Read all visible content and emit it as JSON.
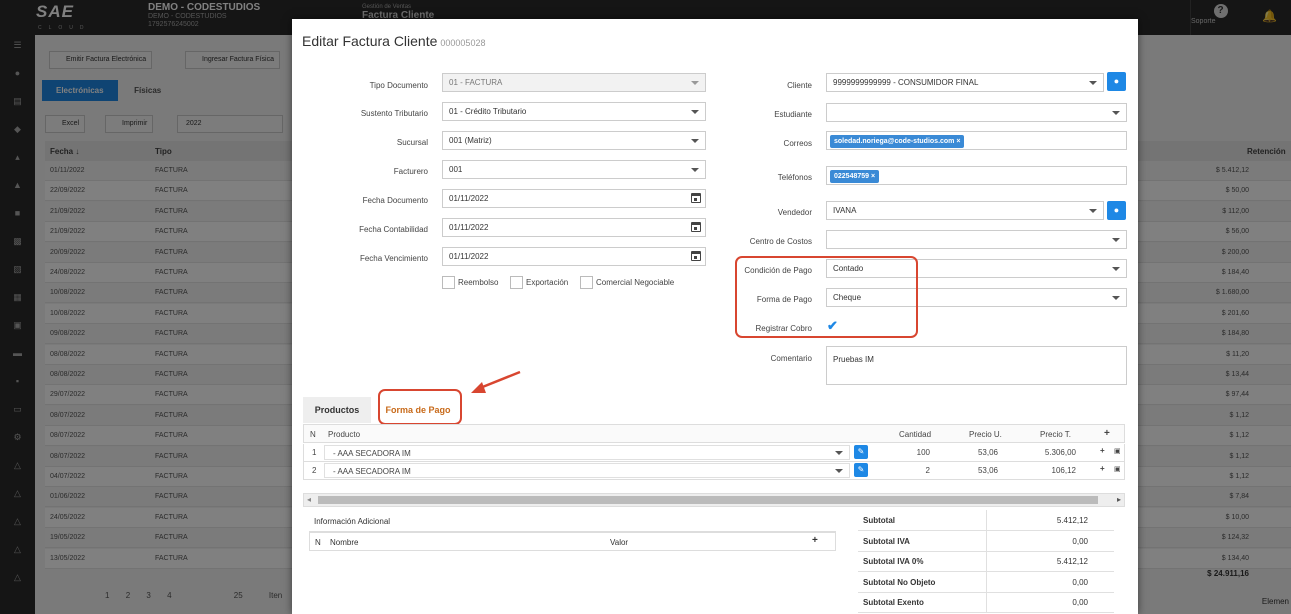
{
  "topbar": {
    "logo_text": "SAE",
    "logo_sub": "CLOUD",
    "company_name": "DEMO - CODESTUDIOS",
    "company_sub": "DEMO - CODESTUDIOS",
    "company_ruc": "1792576245002",
    "module_label": "Gestión de Ventas",
    "module_title": "Factura Cliente",
    "support_label": "Soporte"
  },
  "toolbar": {
    "emit_label": "Emitir Factura Electrónica",
    "ingresar_label": "Ingresar Factura Física",
    "excel_label": "Excel",
    "print_label": "Imprimir",
    "year_value": "2022"
  },
  "list_tabs": [
    "Electrónicas",
    "Físicas"
  ],
  "grid": {
    "col_fecha": "Fecha ↓",
    "col_tipo": "Tipo",
    "col_retencion": "Retención",
    "rows": [
      {
        "fecha": "01/11/2022",
        "tipo": "FACTURA",
        "total": "$ 5.412,12"
      },
      {
        "fecha": "22/09/2022",
        "tipo": "FACTURA",
        "total": "$ 50,00"
      },
      {
        "fecha": "21/09/2022",
        "tipo": "FACTURA",
        "total": "$ 112,00"
      },
      {
        "fecha": "21/09/2022",
        "tipo": "FACTURA",
        "total": "$ 56,00"
      },
      {
        "fecha": "20/09/2022",
        "tipo": "FACTURA",
        "total": "$ 200,00"
      },
      {
        "fecha": "24/08/2022",
        "tipo": "FACTURA",
        "total": "$ 184,40"
      },
      {
        "fecha": "10/08/2022",
        "tipo": "FACTURA",
        "total": "$ 1.680,00"
      },
      {
        "fecha": "10/08/2022",
        "tipo": "FACTURA",
        "total": "$ 201,60"
      },
      {
        "fecha": "09/08/2022",
        "tipo": "FACTURA",
        "total": "$ 184,80"
      },
      {
        "fecha": "08/08/2022",
        "tipo": "FACTURA",
        "total": "$ 11,20"
      },
      {
        "fecha": "08/08/2022",
        "tipo": "FACTURA",
        "total": "$ 13,44"
      },
      {
        "fecha": "29/07/2022",
        "tipo": "FACTURA",
        "total": "$ 97,44"
      },
      {
        "fecha": "08/07/2022",
        "tipo": "FACTURA",
        "total": "$ 1,12"
      },
      {
        "fecha": "08/07/2022",
        "tipo": "FACTURA",
        "total": "$ 1,12"
      },
      {
        "fecha": "08/07/2022",
        "tipo": "FACTURA",
        "total": "$ 1,12"
      },
      {
        "fecha": "04/07/2022",
        "tipo": "FACTURA",
        "total": "$ 1,12"
      },
      {
        "fecha": "01/06/2022",
        "tipo": "FACTURA",
        "total": "$ 7,84"
      },
      {
        "fecha": "24/05/2022",
        "tipo": "FACTURA",
        "total": "$ 10,00"
      },
      {
        "fecha": "19/05/2022",
        "tipo": "FACTURA",
        "total": "$ 124,32"
      },
      {
        "fecha": "13/05/2022",
        "tipo": "FACTURA",
        "total": "$ 134,40"
      }
    ],
    "grand_total": "$ 24.911,16",
    "pager_pages": [
      "1",
      "2",
      "3",
      "4"
    ],
    "page_size": "25",
    "pager_items_label": "Iten",
    "footer_right": "Elemen"
  },
  "modal": {
    "title": "Editar Factura Cliente",
    "number": "000005028",
    "left": {
      "tipo_doc_label": "Tipo Documento",
      "tipo_doc_value": "01 - FACTURA",
      "sustento_label": "Sustento Tributario",
      "sustento_value": "01 - Crédito Tributario",
      "sucursal_label": "Sucursal",
      "sucursal_value": "001 (Matriz)",
      "facturero_label": "Facturero",
      "facturero_value": "001",
      "fecha_doc_label": "Fecha Documento",
      "fecha_doc_value": "01/11/2022",
      "fecha_cont_label": "Fecha Contabilidad",
      "fecha_cont_value": "01/11/2022",
      "fecha_venc_label": "Fecha Vencimiento",
      "fecha_venc_value": "01/11/2022",
      "reembolso_label": "Reembolso",
      "exportacion_label": "Exportación",
      "comercial_label": "Comercial Negociable"
    },
    "right": {
      "cliente_label": "Cliente",
      "cliente_value": "9999999999999 - CONSUMIDOR FINAL",
      "estudiante_label": "Estudiante",
      "estudiante_value": "",
      "correos_label": "Correos",
      "correo_tag": "soledad.noriega@code-studios.com",
      "telefonos_label": "Teléfonos",
      "telefono_tag": "022548759",
      "vendedor_label": "Vendedor",
      "vendedor_value": "IVANA",
      "centro_label": "Centro de Costos",
      "centro_value": "",
      "condicion_label": "Condición de Pago",
      "condicion_value": "Contado",
      "forma_label": "Forma de Pago",
      "forma_value": "Cheque",
      "registrar_label": "Registrar Cobro",
      "registrar_checked": true,
      "comentario_label": "Comentario",
      "comentario_value": "Pruebas IM"
    },
    "tabs": [
      "Productos",
      "Forma de Pago"
    ],
    "products": {
      "headers": {
        "n": "N",
        "producto": "Producto",
        "cantidad": "Cantidad",
        "precio_u": "Precio U.",
        "precio_t": "Precio T."
      },
      "rows": [
        {
          "n": "1",
          "producto": "- AAA SECADORA IM",
          "cantidad": "100",
          "precio_u": "53,06",
          "precio_t": "5.306,00"
        },
        {
          "n": "2",
          "producto": "- AAA SECADORA IM",
          "cantidad": "2",
          "precio_u": "53,06",
          "precio_t": "106,12"
        }
      ]
    },
    "info_adicional": {
      "title": "Información Adicional",
      "col_n": "N",
      "col_nombre": "Nombre",
      "col_valor": "Valor"
    },
    "summary": [
      {
        "label": "Subtotal",
        "value": "5.412,12"
      },
      {
        "label": "Subtotal IVA",
        "value": "0,00"
      },
      {
        "label": "Subtotal IVA 0%",
        "value": "5.412,12"
      },
      {
        "label": "Subtotal No Objeto",
        "value": "0,00"
      },
      {
        "label": "Subtotal Exento",
        "value": "0,00"
      }
    ]
  },
  "colors": {
    "accent": "#1e88e5",
    "highlight": "#d84630",
    "tag": "#3a8ad6"
  }
}
